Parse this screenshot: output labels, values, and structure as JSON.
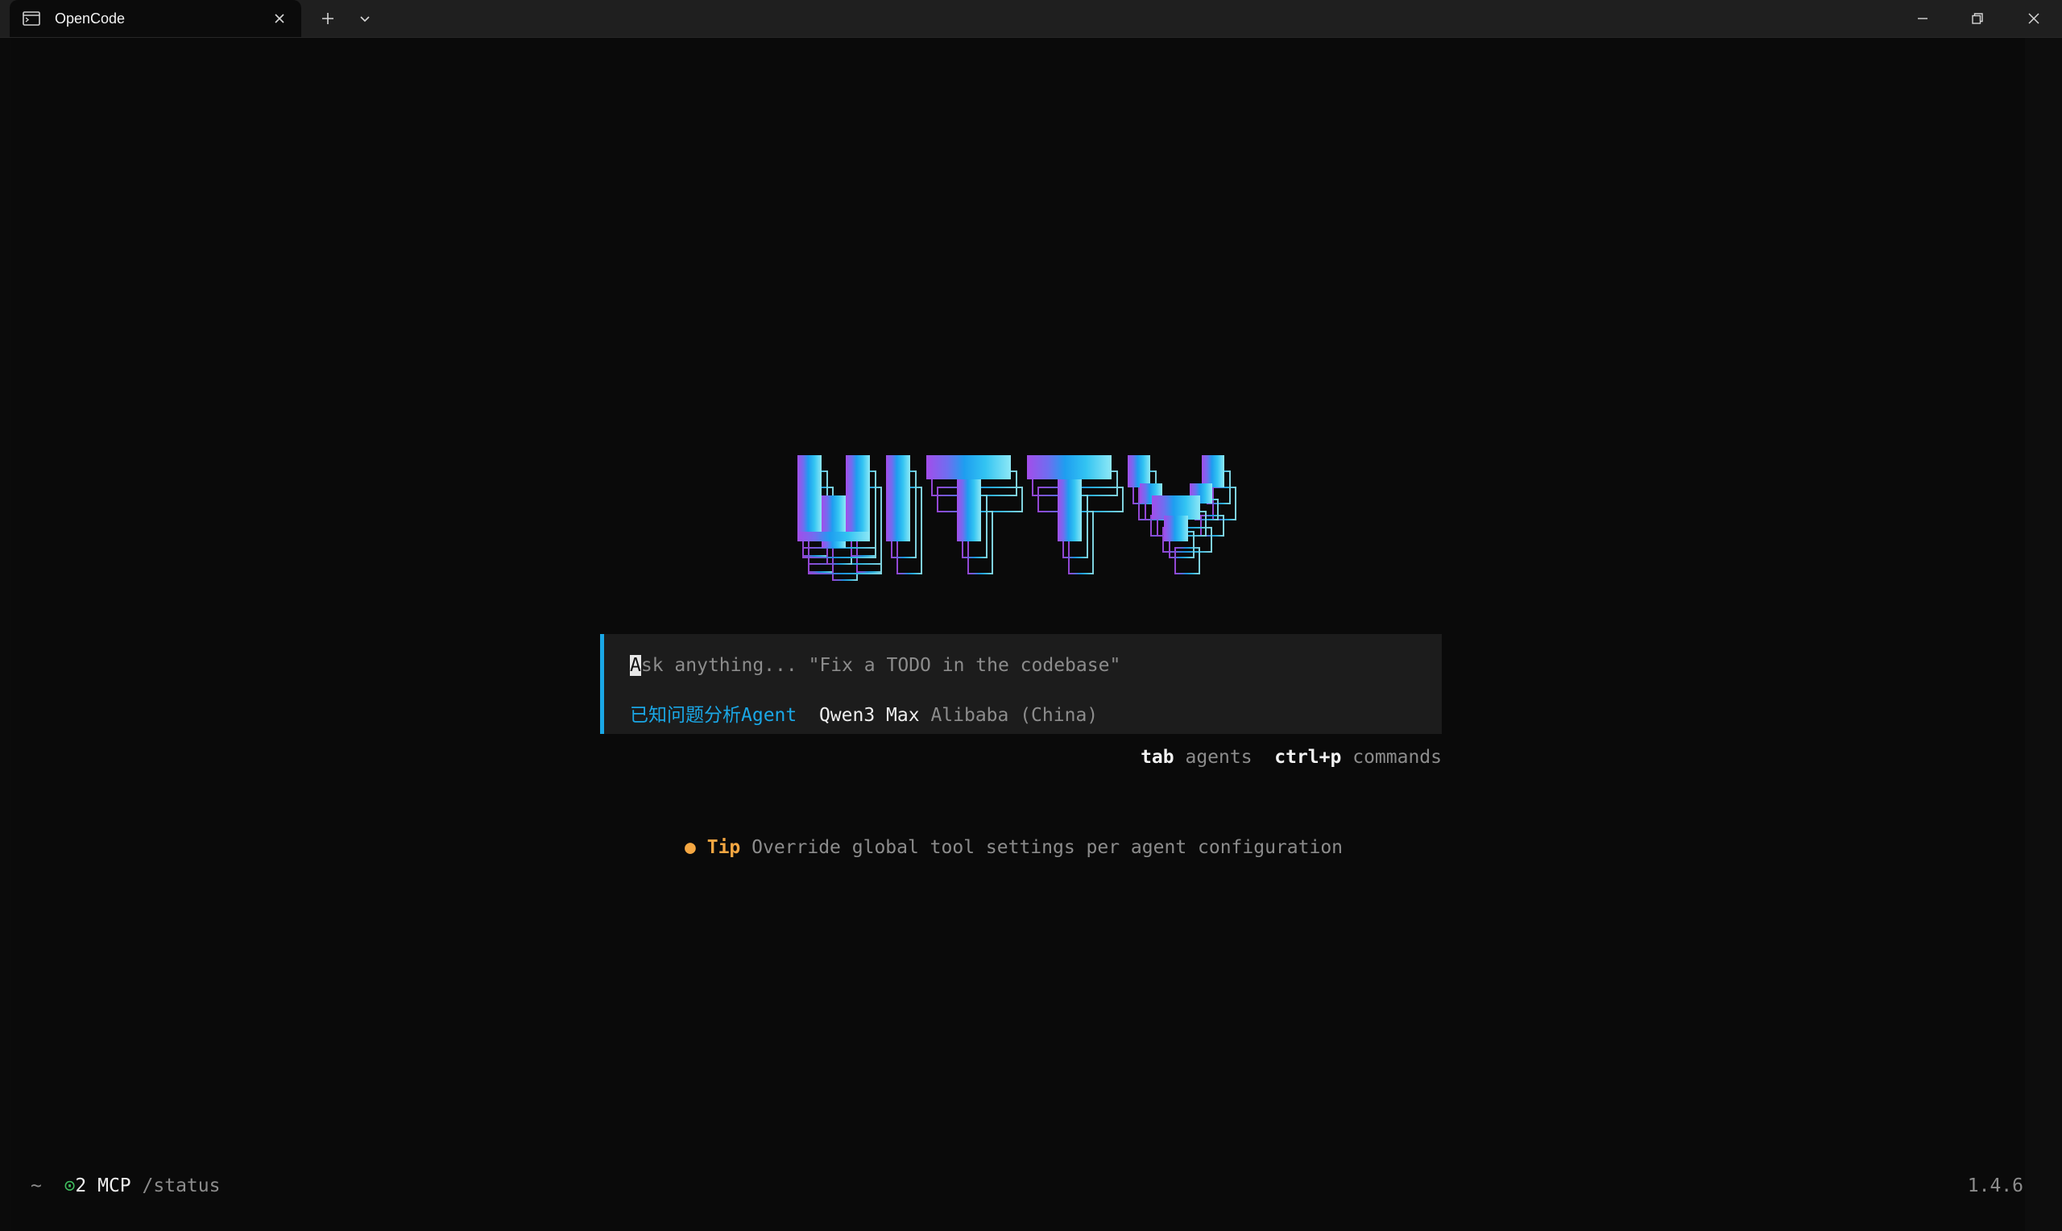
{
  "titlebar": {
    "tab_title": "OpenCode",
    "icons": {
      "tab": "terminal-icon",
      "close_tab": "close-icon",
      "new_tab": "plus-icon",
      "dropdown": "chevron-down-icon",
      "minimize": "minimize-icon",
      "restore": "restore-icon",
      "close_window": "close-icon"
    }
  },
  "logo": {
    "text": "WITTY",
    "gradient": [
      "#a34dea",
      "#5b7bf0",
      "#1e9ef0",
      "#33c4f2",
      "#8ee8f6"
    ]
  },
  "prompt": {
    "cursor_char": "A",
    "placeholder_rest": "sk anything... \"Fix a TODO in the codebase\"",
    "agent": "已知问题分析Agent",
    "model": "Qwen3 Max",
    "provider": "Alibaba (China)"
  },
  "hints": [
    {
      "key": "tab",
      "desc": "agents"
    },
    {
      "key": "ctrl+p",
      "desc": "commands"
    }
  ],
  "tip": {
    "bullet": "●",
    "label": "Tip",
    "text": "Override global tool settings per agent configuration"
  },
  "status": {
    "cwd": "~",
    "mcp_icon": "⊙",
    "mcp": "2 MCP",
    "command": "/status",
    "version": "1.4.6"
  },
  "colors": {
    "accent": "#1aa7e6",
    "tip": "#f5a742",
    "mcp_ok": "#3fbf5f",
    "background": "#0a0a0a"
  }
}
